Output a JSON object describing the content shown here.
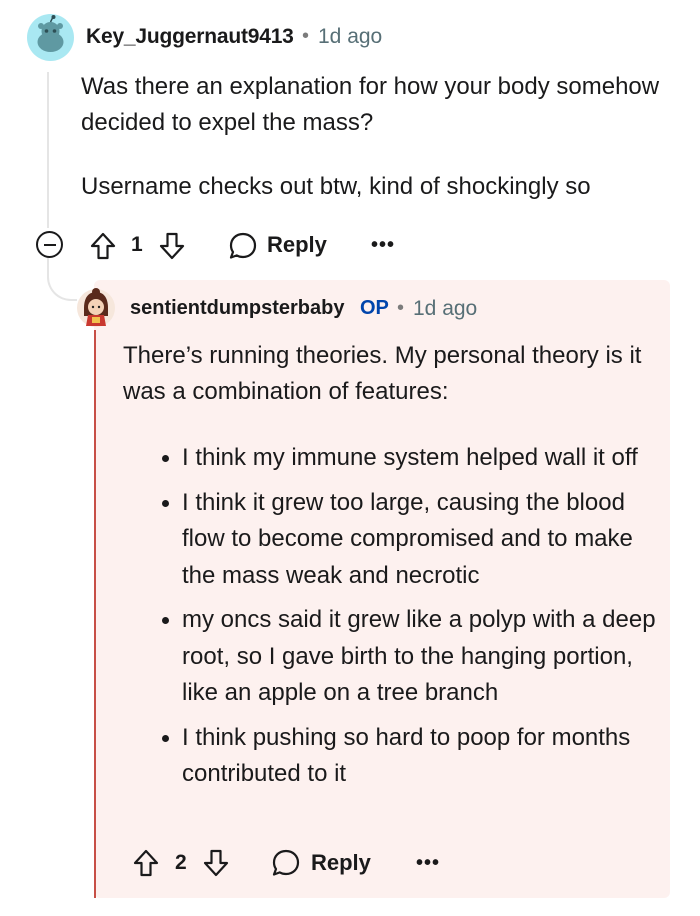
{
  "comment": {
    "username": "Key_Juggernaut9413",
    "separator": "•",
    "time": "1d ago",
    "paragraphs": [
      "Was there an explanation for how your body somehow decided to expel the mass?",
      "Username checks out btw, kind of shockingly so"
    ],
    "vote_count": "1",
    "reply_label": "Reply",
    "more_label": "•••",
    "avatar_color": "#a9e8f2"
  },
  "reply": {
    "username": "sentientdumpsterbaby",
    "op_badge": "OP",
    "separator": "•",
    "time": "1d ago",
    "intro": "There’s running theories. My personal theory is it was a combination of features:",
    "bullets": [
      "I think my immune system helped wall it off",
      "I think it grew too large, causing the blood flow to become compromised and to make the mass weak and necrotic",
      "my oncs said it grew like a polyp with a deep root, so I gave birth to the hanging portion, like an apple on a tree branch",
      "I think pushing so hard to poop for months contributed to it"
    ],
    "vote_count": "2",
    "reply_label": "Reply",
    "more_label": "•••",
    "card_background": "#fdf1ef",
    "thread_color": "#c74f46",
    "op_color": "#0045ac"
  }
}
